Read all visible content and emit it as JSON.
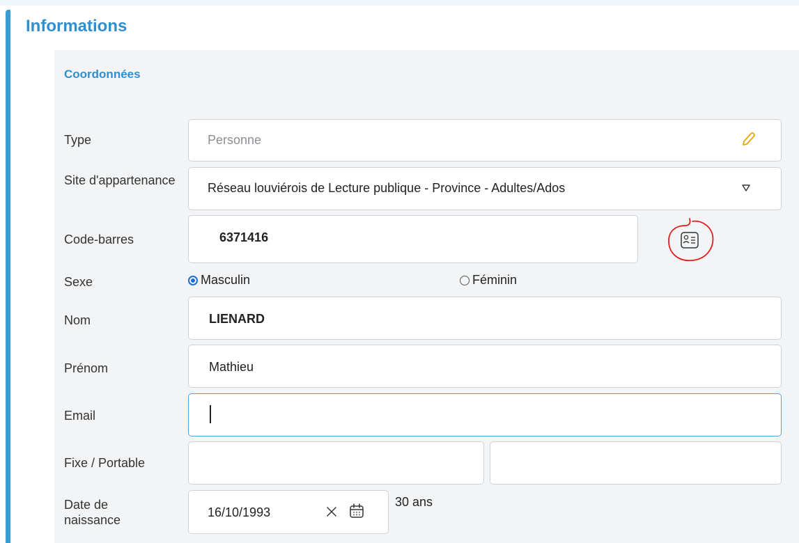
{
  "section": {
    "title": "Informations",
    "subtitle": "Coordonnées"
  },
  "labels": {
    "type": "Type",
    "site": "Site d'appartenance",
    "barcode": "Code-barres",
    "sexe": "Sexe",
    "nom": "Nom",
    "prenom": "Prénom",
    "email": "Email",
    "phones": "Fixe / Portable",
    "birth": "Date de naissance"
  },
  "fields": {
    "type_value": "Personne",
    "site_value": "Réseau louviérois de Lecture publique - Province - Adultes/Ados",
    "barcode_value": "6371416",
    "nom_value": "LIENARD",
    "prenom_value": "Mathieu",
    "email_value": "",
    "fixe_value": "",
    "portable_value": "",
    "birth_value": "16/10/1993",
    "age_text": "30 ans"
  },
  "sexe_options": [
    {
      "label": "Masculin",
      "selected": true
    },
    {
      "label": "Féminin",
      "selected": false
    }
  ],
  "icons": {
    "type_edit": "pencil-icon",
    "site_dropdown": "triangle-down-icon",
    "barcode_card": "id-card-icon",
    "birth_clear": "close-icon",
    "birth_calendar": "calendar-icon"
  },
  "colors": {
    "accent": "#2f8fd0",
    "pencil": "#e3a60b",
    "annotation": "#e02020",
    "radio": "#1f6fd1"
  }
}
